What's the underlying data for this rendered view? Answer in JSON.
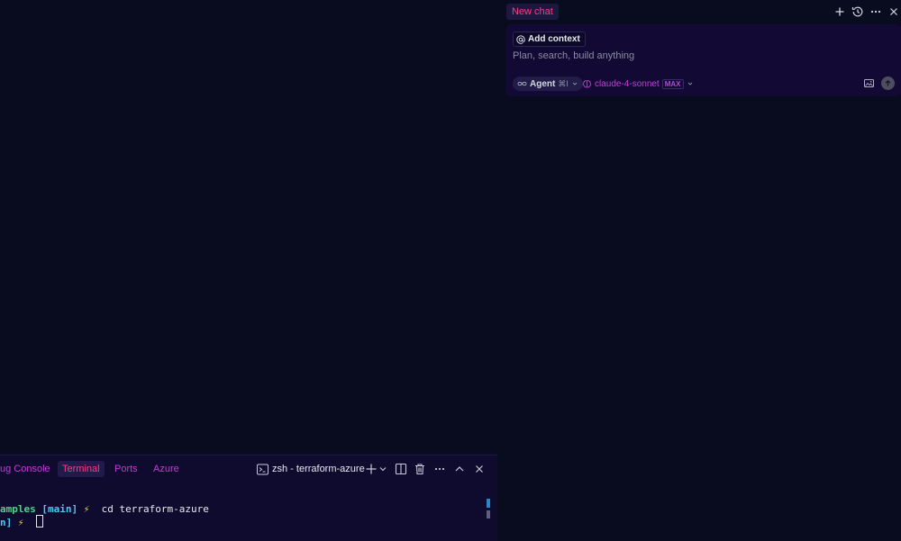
{
  "terminal_panel": {
    "tabs": [
      {
        "label": "ug Console",
        "active": false
      },
      {
        "label": "Terminal",
        "active": true
      },
      {
        "label": "Ports",
        "active": false
      },
      {
        "label": "Azure",
        "active": false
      }
    ],
    "selector_label": "zsh - terraform-azure",
    "lines": [
      {
        "segments": [
          "amples",
          "[main]",
          "⚡",
          "cd terraform-azure"
        ]
      },
      {
        "segments": [
          "n]",
          "⚡"
        ]
      }
    ]
  },
  "chat": {
    "tab_label": "New chat",
    "add_context_label": "Add context",
    "placeholder": "Plan, search, build anything",
    "agent_label": "Agent",
    "agent_shortcut": "⌘I",
    "model_name": "claude-4-sonnet",
    "model_badge": "MAX"
  },
  "colors": {
    "background": "#090c1e",
    "panel": "#0f0b2e",
    "accent_pink": "#ff3d7f",
    "accent_purple": "#c33cd6"
  },
  "icons": [
    "terminal-icon",
    "plus-icon",
    "chevron-down-icon",
    "split-icon",
    "trash-icon",
    "more-icon",
    "chevron-up-icon",
    "close-icon",
    "history-icon",
    "at-icon",
    "infinity-icon",
    "brain-icon",
    "image-icon",
    "arrow-up-icon"
  ]
}
